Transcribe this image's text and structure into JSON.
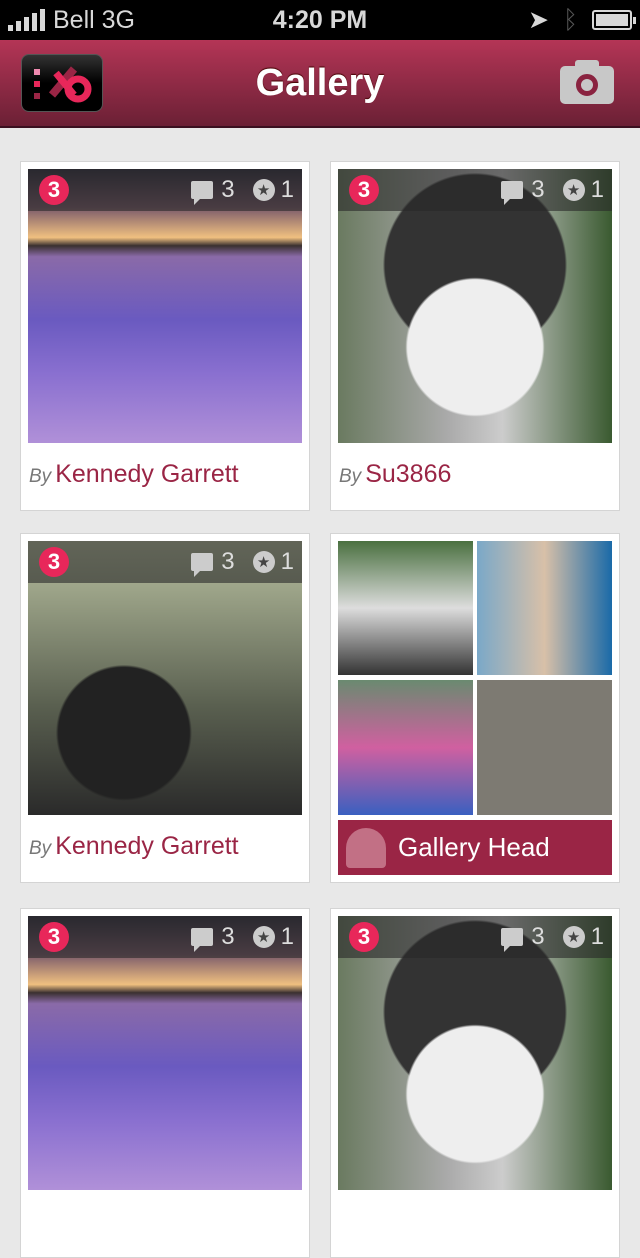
{
  "status_bar": {
    "carrier": "Bell 3G",
    "time": "4:20 PM"
  },
  "nav": {
    "title": "Gallery",
    "logo": "app-logo",
    "camera_icon": "camera-icon"
  },
  "colors": {
    "accent": "#9a2545",
    "badge": "#e8275a"
  },
  "cards": [
    {
      "badge": "3",
      "comments": "3",
      "stars": "1",
      "by": "By",
      "author": "Kennedy Garrett"
    },
    {
      "badge": "3",
      "comments": "3",
      "stars": "1",
      "by": "By",
      "author": "Su3866"
    },
    {
      "badge": "3",
      "comments": "3",
      "stars": "1",
      "by": "By",
      "author": "Kennedy Garrett"
    },
    {
      "label": "Gallery Head"
    },
    {
      "badge": "3",
      "comments": "3",
      "stars": "1"
    },
    {
      "badge": "3",
      "comments": "3",
      "stars": "1"
    }
  ]
}
